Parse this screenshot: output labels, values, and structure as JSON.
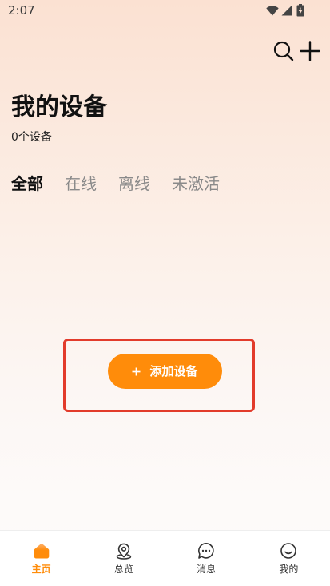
{
  "status_bar": {
    "time": "2:07",
    "icons": [
      "wifi-icon",
      "signal-icon",
      "battery-charging-icon"
    ]
  },
  "header": {
    "actions": [
      {
        "icon": "search-icon"
      },
      {
        "icon": "plus-icon"
      }
    ]
  },
  "page": {
    "title": "我的设备",
    "subtitle": "0个设备"
  },
  "tabs": [
    {
      "label": "全部",
      "selected": true
    },
    {
      "label": "在线",
      "selected": false
    },
    {
      "label": "离线",
      "selected": false
    },
    {
      "label": "未激活",
      "selected": false
    }
  ],
  "empty_state": {
    "add_button": {
      "icon": "plus-icon",
      "label": "添加设备"
    }
  },
  "bottom_nav": {
    "items": [
      {
        "label": "主页",
        "icon": "home-icon",
        "selected": true
      },
      {
        "label": "总览",
        "icon": "location-pin-icon",
        "selected": false
      },
      {
        "label": "消息",
        "icon": "chat-bubble-icon",
        "selected": false
      },
      {
        "label": "我的",
        "icon": "smiley-face-icon",
        "selected": false
      }
    ]
  },
  "colors": {
    "accent": "#ff8c0a",
    "highlight_border": "#e23b2b",
    "text_primary": "#111111",
    "text_secondary": "#8a8a8a",
    "nav_background": "#ffffff"
  }
}
